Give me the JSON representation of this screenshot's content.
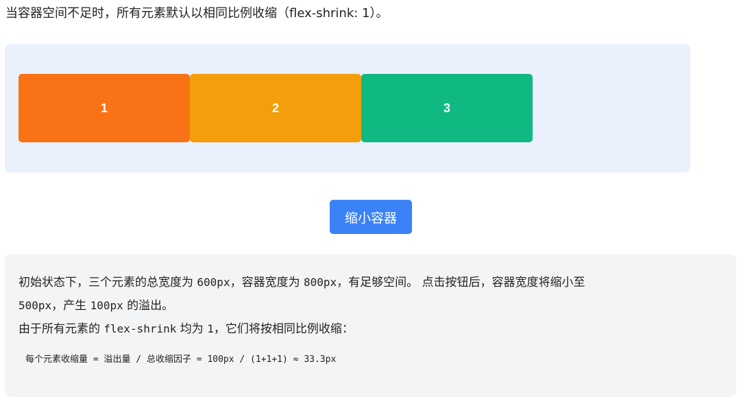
{
  "intro": {
    "text": "当容器空间不足时，所有元素默认以相同比例收缩（flex-shrink: 1）。"
  },
  "demo": {
    "background": "#eaf1fc",
    "items": [
      {
        "label": "1",
        "color": "#f97316"
      },
      {
        "label": "2",
        "color": "#f59e0b"
      },
      {
        "label": "3",
        "color": "#10b981"
      }
    ]
  },
  "button": {
    "label": "缩小容器",
    "color": "#3b82f6"
  },
  "explanation": {
    "p1_a": "初始状态下，三个元素的总宽度为 ",
    "p1_code1": "600px",
    "p1_b": "，容器宽度为 ",
    "p1_code2": "800px",
    "p1_c": "，有足够空间。 点击按钮后，容器宽度将缩小至",
    "p2_code1": "500px",
    "p2_a": "，产生 ",
    "p2_code2": "100px",
    "p2_b": " 的溢出。",
    "p3_a": "由于所有元素的 ",
    "p3_code1": "flex-shrink",
    "p3_b": " 均为 ",
    "p3_code2": "1",
    "p3_c": "，它们将按相同比例收缩：",
    "formula": "每个元素收缩量 = 溢出量 / 总收缩因子 = 100px / (1+1+1) ≈ 33.3px"
  }
}
